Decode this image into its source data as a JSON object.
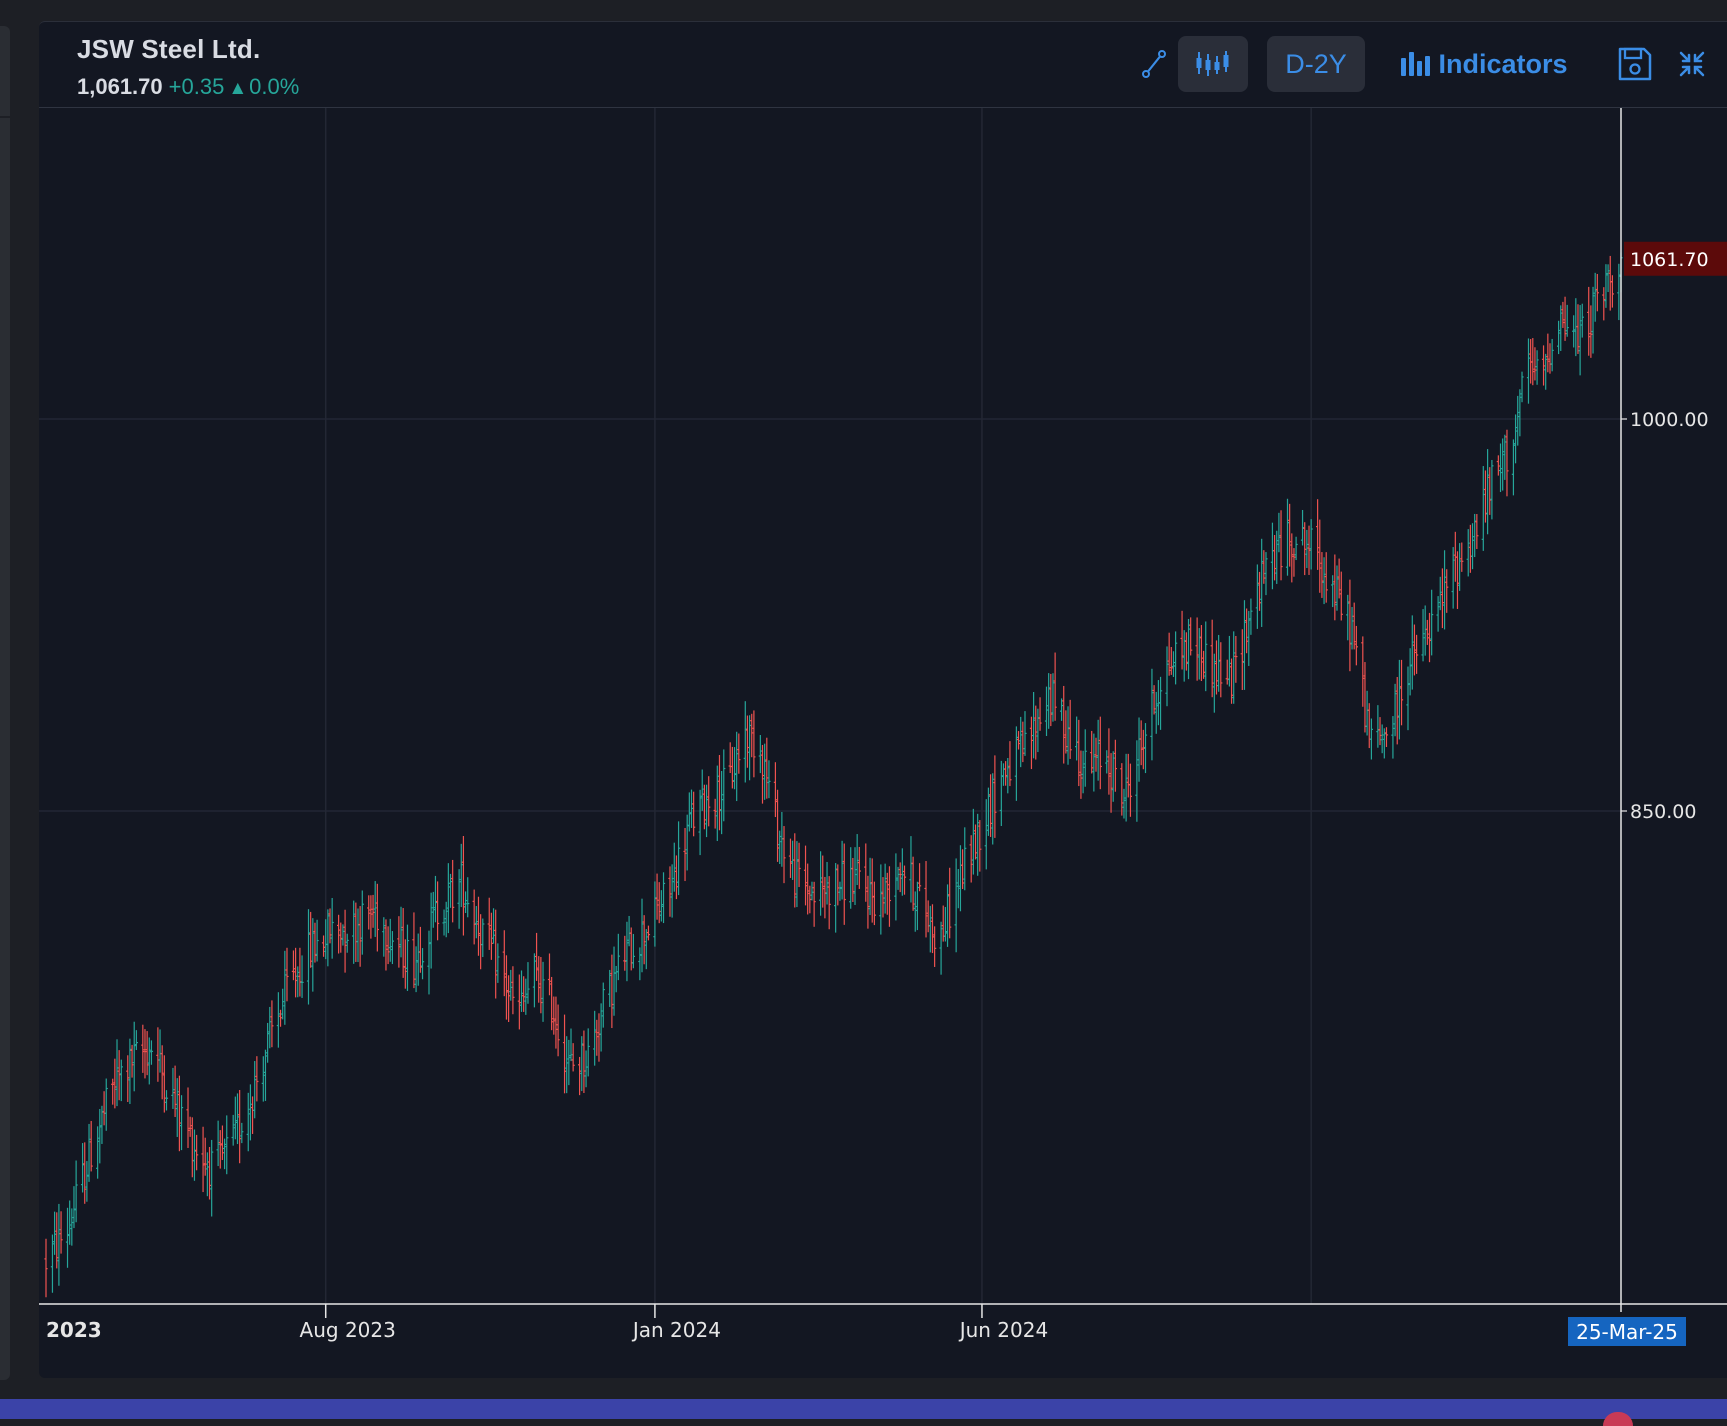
{
  "header": {
    "symbol": "JSW Steel Ltd.",
    "last": "1,061.70",
    "change": "+0.35",
    "change_arrow": "▲",
    "change_pct": "0.0%"
  },
  "toolbar": {
    "draw_icon": "line-tool-icon",
    "chart_type_icon": "candlestick-icon",
    "timeframe_label": "D-2Y",
    "indicators_icon": "bar-chart-icon",
    "indicators_label": "Indicators",
    "save_icon": "save-icon",
    "collapse_icon": "compress-icon"
  },
  "colors": {
    "up": "#26a69a",
    "down": "#ef5350",
    "background": "#131722",
    "accent": "#3b8de6",
    "last_price_tag": "#5c0a0a",
    "date_tag": "#1565c0"
  },
  "chart_data": {
    "type": "ohlc",
    "title": "JSW Steel Ltd.",
    "timeframe": "D-2Y",
    "x_range": [
      "2023-03-24",
      "2025-03-25"
    ],
    "y_range": [
      700,
      1100
    ],
    "grid": true,
    "y_ticks": [
      {
        "value": 1000.0,
        "label": "1000.00"
      },
      {
        "value": 850.0,
        "label": "850.00"
      }
    ],
    "x_ticks": [
      {
        "date": "2023-01-01",
        "label": "2023",
        "bold": true
      },
      {
        "date": "2023-08-01",
        "label": "Aug 2023"
      },
      {
        "date": "2024-01-01",
        "label": "Jan 2024"
      },
      {
        "date": "2024-06-01",
        "label": "Jun 2024"
      }
    ],
    "crosshair": {
      "date": "2025-03-25",
      "label": "25-Mar-25"
    },
    "last_price": {
      "value": 1061.7,
      "label": "1061.70"
    },
    "close_path": [
      [
        "2023-03-24",
        678
      ],
      [
        "2023-04-03",
        690
      ],
      [
        "2023-04-14",
        720
      ],
      [
        "2023-04-25",
        746
      ],
      [
        "2023-05-04",
        755
      ],
      [
        "2023-05-12",
        760
      ],
      [
        "2023-05-22",
        740
      ],
      [
        "2023-06-01",
        722
      ],
      [
        "2023-06-10",
        712
      ],
      [
        "2023-06-20",
        725
      ],
      [
        "2023-06-29",
        745
      ],
      [
        "2023-07-07",
        765
      ],
      [
        "2023-07-14",
        782
      ],
      [
        "2023-07-25",
        797
      ],
      [
        "2023-08-03",
        804
      ],
      [
        "2023-08-14",
        806
      ],
      [
        "2023-08-24",
        812
      ],
      [
        "2023-09-02",
        800
      ],
      [
        "2023-09-11",
        793
      ],
      [
        "2023-09-22",
        812
      ],
      [
        "2023-10-03",
        823
      ],
      [
        "2023-10-12",
        805
      ],
      [
        "2023-10-21",
        790
      ],
      [
        "2023-10-29",
        772
      ],
      [
        "2023-11-06",
        787
      ],
      [
        "2023-11-14",
        776
      ],
      [
        "2023-11-22",
        752
      ],
      [
        "2023-12-01",
        757
      ],
      [
        "2023-12-08",
        775
      ],
      [
        "2023-12-18",
        795
      ],
      [
        "2023-12-28",
        805
      ],
      [
        "2024-01-08",
        820
      ],
      [
        "2024-01-17",
        845
      ],
      [
        "2024-01-26",
        855
      ],
      [
        "2024-02-04",
        860
      ],
      [
        "2024-02-12",
        880
      ],
      [
        "2024-02-19",
        875
      ],
      [
        "2024-02-27",
        843
      ],
      [
        "2024-03-06",
        825
      ],
      [
        "2024-03-15",
        818
      ],
      [
        "2024-03-25",
        822
      ],
      [
        "2024-04-04",
        824
      ],
      [
        "2024-04-14",
        815
      ],
      [
        "2024-04-24",
        830
      ],
      [
        "2024-05-04",
        815
      ],
      [
        "2024-05-12",
        800
      ],
      [
        "2024-05-22",
        825
      ],
      [
        "2024-06-01",
        845
      ],
      [
        "2024-06-11",
        865
      ],
      [
        "2024-06-22",
        875
      ],
      [
        "2024-07-02",
        895
      ],
      [
        "2024-07-11",
        880
      ],
      [
        "2024-07-20",
        865
      ],
      [
        "2024-07-28",
        872
      ],
      [
        "2024-08-06",
        855
      ],
      [
        "2024-08-14",
        875
      ],
      [
        "2024-08-23",
        900
      ],
      [
        "2024-08-30",
        910
      ],
      [
        "2024-09-07",
        915
      ],
      [
        "2024-09-16",
        905
      ],
      [
        "2024-09-25",
        900
      ],
      [
        "2024-10-05",
        930
      ],
      [
        "2024-10-14",
        948
      ],
      [
        "2024-10-24",
        955
      ],
      [
        "2024-11-03",
        950
      ],
      [
        "2024-11-11",
        935
      ],
      [
        "2024-11-20",
        920
      ],
      [
        "2024-11-29",
        875
      ],
      [
        "2024-12-08",
        882
      ],
      [
        "2024-12-16",
        905
      ],
      [
        "2024-12-26",
        918
      ],
      [
        "2025-01-05",
        940
      ],
      [
        "2025-01-15",
        955
      ],
      [
        "2025-01-24",
        975
      ],
      [
        "2025-02-02",
        990
      ],
      [
        "2025-02-10",
        1020
      ],
      [
        "2025-02-16",
        1015
      ],
      [
        "2025-02-24",
        1040
      ],
      [
        "2025-03-05",
        1030
      ],
      [
        "2025-03-14",
        1045
      ],
      [
        "2025-03-25",
        1061.7
      ]
    ]
  }
}
